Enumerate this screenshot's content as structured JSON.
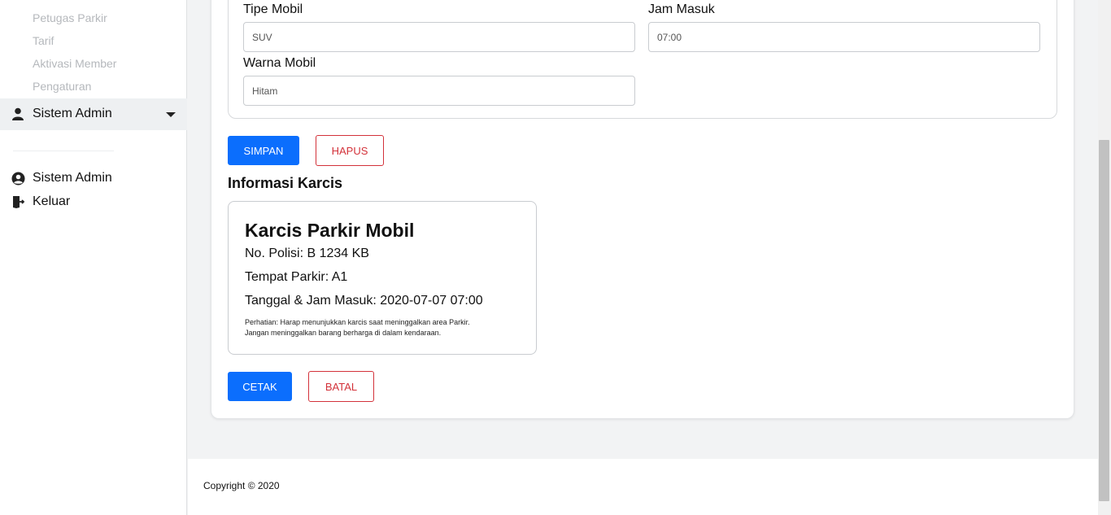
{
  "sidebar": {
    "sub_items": [
      "Petugas Parkir",
      "Tarif",
      "Aktivasi Member",
      "Pengaturan"
    ],
    "active_menu": {
      "label": "Sistem Admin",
      "icon": "user-icon"
    },
    "bottom_items": [
      {
        "label": "Sistem Admin",
        "icon": "user-circle-icon"
      },
      {
        "label": "Keluar",
        "icon": "logout-icon"
      }
    ]
  },
  "form": {
    "tipe_mobil": {
      "label": "Tipe Mobil",
      "value": "SUV"
    },
    "jam_masuk": {
      "label": "Jam Masuk",
      "value": "07:00"
    },
    "warna_mobil": {
      "label": "Warna Mobil",
      "value": "Hitam"
    },
    "save_label": "SIMPAN",
    "delete_label": "HAPUS"
  },
  "ticket_section": {
    "title": "Informasi Karcis",
    "ticket_title": "Karcis Parkir Mobil",
    "no_polisi": "No. Polisi: B 1234 KB",
    "tempat_parkir": "Tempat Parkir: A1",
    "tanggal_jam": "Tanggal & Jam Masuk: 2020-07-07 07:00",
    "note_line1": "Perhatian: Harap menunjukkan karcis saat meninggalkan area Parkir.",
    "note_line2": "Jangan meninggalkan barang berharga di dalam kendaraan.",
    "print_label": "CETAK",
    "cancel_label": "BATAL"
  },
  "footer": {
    "copyright": "Copyright © 2020"
  },
  "colors": {
    "primary": "#0b6efd",
    "danger": "#d3323a",
    "sidebar_active_bg": "#eef0f2"
  }
}
